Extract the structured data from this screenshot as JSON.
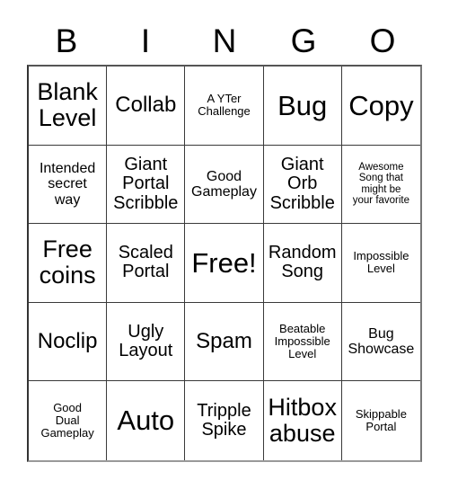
{
  "card": {
    "title_letters": [
      "B",
      "I",
      "N",
      "G",
      "O"
    ],
    "columns": 5,
    "rows": 5,
    "background_color": "#ffffff",
    "text_color": "#000000",
    "border_color": "#3a3a3a",
    "free_space": "Free!",
    "free_space_position": "center",
    "cells": [
      {
        "text": "Blank\nLevel",
        "size": "fs-xl"
      },
      {
        "text": "Collab",
        "size": "fs-lg"
      },
      {
        "text": "A YTer\nChallenge",
        "size": "fs-xs"
      },
      {
        "text": "Bug",
        "size": "fs-xxl"
      },
      {
        "text": "Copy",
        "size": "fs-xxl"
      },
      {
        "text": "Intended\nsecret\nway",
        "size": "fs-sm"
      },
      {
        "text": "Giant\nPortal\nScribble",
        "size": "fs-md"
      },
      {
        "text": "Good\nGameplay",
        "size": "fs-sm"
      },
      {
        "text": "Giant\nOrb\nScribble",
        "size": "fs-md"
      },
      {
        "text": "Awesome\nSong that\nmight be\nyour favorite",
        "size": "fs-xxs"
      },
      {
        "text": "Free\ncoins",
        "size": "fs-xl"
      },
      {
        "text": "Scaled\nPortal",
        "size": "fs-md"
      },
      {
        "text": "Free!",
        "size": "fs-xxl"
      },
      {
        "text": "Random\nSong",
        "size": "fs-md"
      },
      {
        "text": "Impossible\nLevel",
        "size": "fs-xs"
      },
      {
        "text": "Noclip",
        "size": "fs-lg"
      },
      {
        "text": "Ugly\nLayout",
        "size": "fs-md"
      },
      {
        "text": "Spam",
        "size": "fs-lg"
      },
      {
        "text": "Beatable\nImpossible\nLevel",
        "size": "fs-xs"
      },
      {
        "text": "Bug\nShowcase",
        "size": "fs-sm"
      },
      {
        "text": "Good\nDual\nGameplay",
        "size": "fs-xs"
      },
      {
        "text": "Auto",
        "size": "fs-xxl"
      },
      {
        "text": "Tripple\nSpike",
        "size": "fs-md"
      },
      {
        "text": "Hitbox\nabuse",
        "size": "fs-xl"
      },
      {
        "text": "Skippable\nPortal",
        "size": "fs-xs"
      }
    ]
  }
}
